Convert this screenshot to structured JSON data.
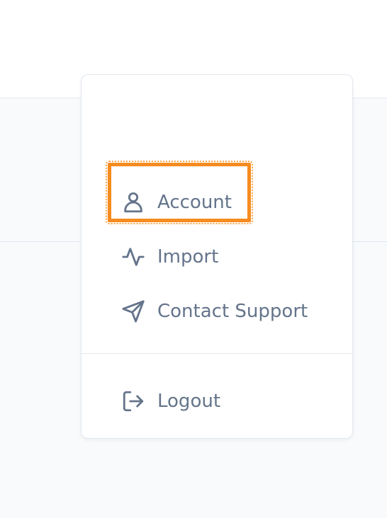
{
  "menu": {
    "items": [
      {
        "label": "Account",
        "icon": "user-icon"
      },
      {
        "label": "Import",
        "icon": "activity-icon"
      },
      {
        "label": "Contact Support",
        "icon": "send-icon"
      }
    ],
    "logout": {
      "label": "Logout",
      "icon": "logout-icon"
    }
  },
  "highlight": {
    "target": "Account",
    "color": "#f68b1f"
  },
  "colors": {
    "text": "#64748b",
    "border": "#e2e8f0",
    "background": "#f8fafc",
    "accent": "#0e7490"
  }
}
